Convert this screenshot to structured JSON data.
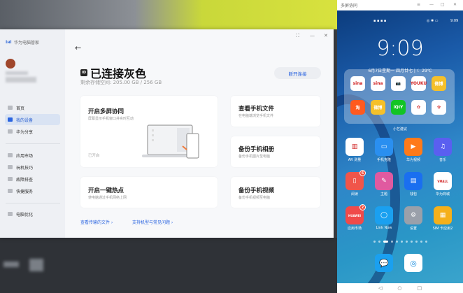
{
  "desktop_app": {
    "app_name": "华为电脑管家",
    "sidebar": {
      "items": [
        {
          "label": "首页",
          "icon": "home-icon"
        },
        {
          "label": "我的设备",
          "icon": "device-icon",
          "active": true
        },
        {
          "label": "华为分享",
          "icon": "share-icon"
        },
        {
          "label": "应用市场",
          "icon": "app-store-icon"
        },
        {
          "label": "玩机技巧",
          "icon": "tips-icon"
        },
        {
          "label": "故障排查",
          "icon": "wrench-icon"
        },
        {
          "label": "快捷服务",
          "icon": "service-icon"
        },
        {
          "label": "电脑优化",
          "icon": "optimize-icon"
        }
      ]
    },
    "header": {
      "back": "←",
      "id_badge": "ID",
      "title": "已连接灰色",
      "storage": "剩余存储空间:  205.00 GB  /  256 GB",
      "disconnect": "断开连接",
      "controls": {
        "restore": "⛶",
        "minimize": "—",
        "close": "✕"
      }
    },
    "cards": [
      {
        "title": "开启多屏协同",
        "subtitle": "屏幕显示手机窗口并实时互动",
        "status": "已开启"
      },
      {
        "title": "查看手机文件",
        "subtitle": "在电脑端浏览手机文件"
      },
      {
        "title": "备份手机相册",
        "subtitle": "备份手机图片至电脑"
      },
      {
        "title": "开启一键热点",
        "subtitle": "使电脑通过手机网络上网"
      },
      {
        "title": "备份手机视频",
        "subtitle": "备份手机视频至电脑"
      }
    ],
    "links": [
      "查看传输的文件 ›",
      "支持机型与常见问题 ›"
    ]
  },
  "phone": {
    "window_title": "多屏协同",
    "status_time": "9:09",
    "clock": "9:09",
    "date": "6月7日星期一  四月廿七",
    "weather": "☾ 29℃",
    "folder_label": "小艺建议",
    "folder_apps": [
      {
        "t": "sina",
        "c": "#ffffff"
      },
      {
        "t": "sina",
        "c": "#ffffff"
      },
      {
        "t": "📷",
        "c": "#ffffff"
      },
      {
        "t": "YOUKU",
        "c": "#ffffff"
      },
      {
        "t": "微博",
        "c": "#f5c02a"
      },
      {
        "t": "淘",
        "c": "#ff5a1f"
      },
      {
        "t": "微博",
        "c": "#f5c02a"
      },
      {
        "t": "iQIY",
        "c": "#12c424"
      },
      {
        "t": "✿",
        "c": "#ffffff"
      },
      {
        "t": "✿",
        "c": "#ffffff"
      }
    ],
    "apps": [
      {
        "label": "AR 测量",
        "color": "#ffffff",
        "glyph": "▥"
      },
      {
        "label": "手机克隆",
        "color": "#2a8ff0",
        "glyph": "▭"
      },
      {
        "label": "华为视频",
        "color": "#ff7a1a",
        "glyph": "▶"
      },
      {
        "label": "音乐",
        "color": "#5a5ff0",
        "glyph": "♫"
      },
      {
        "label": "阅读",
        "color": "#f0554a",
        "glyph": "▯",
        "badge": "6"
      },
      {
        "label": "主题",
        "color": "#e05aa0",
        "glyph": "✎"
      },
      {
        "label": "钱包",
        "color": "#1a6ff0",
        "glyph": "▤"
      },
      {
        "label": "华为商城",
        "color": "#ffffff",
        "glyph": "VMALL"
      },
      {
        "label": "应用市场",
        "color": "#f04a4a",
        "glyph": "HUAWEI",
        "badge": "2"
      },
      {
        "label": "Link Now",
        "color": "#1aa0f0",
        "glyph": "◯"
      },
      {
        "label": "设置",
        "color": "#9aa0aa",
        "glyph": "⚙"
      },
      {
        "label": "SIM 卡应用2",
        "color": "#f5b01a",
        "glyph": "▦"
      }
    ],
    "dock": [
      {
        "name": "messages",
        "color": "#1aa0f0",
        "glyph": "💬"
      },
      {
        "name": "browser",
        "color": "#ffffff",
        "glyph": "◎"
      }
    ],
    "nav": {
      "back": "◁",
      "home": "○",
      "recent": "□"
    }
  }
}
